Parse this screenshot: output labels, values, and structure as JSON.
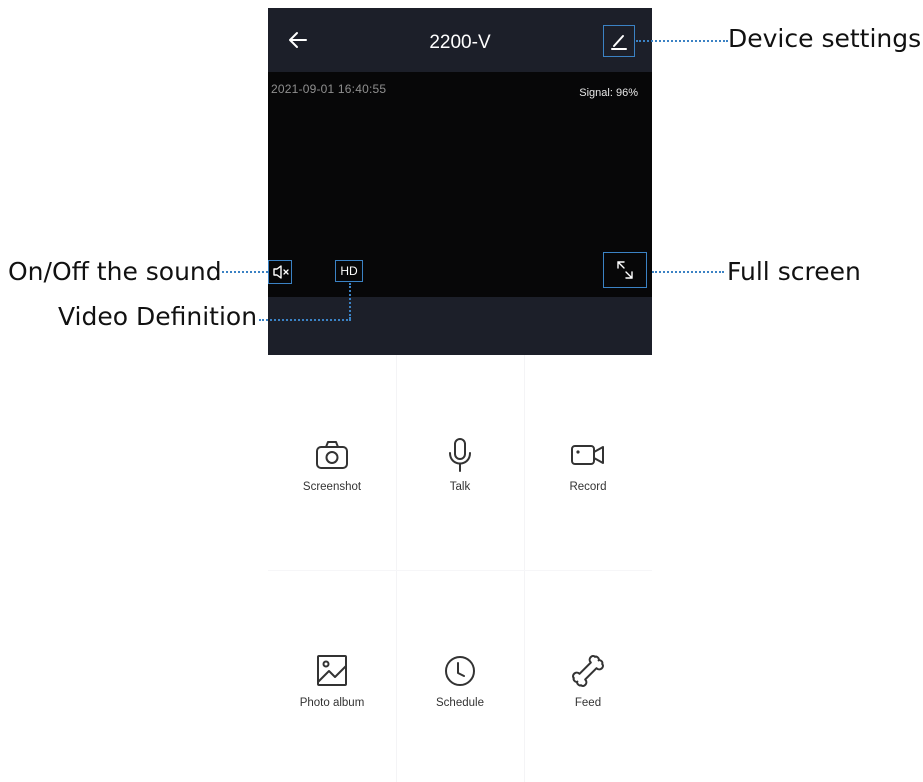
{
  "header": {
    "title": "2200-V"
  },
  "video": {
    "timestamp": "2021-09-01 16:40:55",
    "signal": "Signal: 96%",
    "hd_label": "HD"
  },
  "actions": [
    {
      "label": "Screenshot",
      "icon": "camera-icon"
    },
    {
      "label": "Talk",
      "icon": "microphone-icon"
    },
    {
      "label": "Record",
      "icon": "video-camera-icon"
    },
    {
      "label": "Photo album",
      "icon": "photo-album-icon"
    },
    {
      "label": "Schedule",
      "icon": "clock-icon"
    },
    {
      "label": "Feed",
      "icon": "bone-icon"
    }
  ],
  "annotations": {
    "device_settings": "Device settings",
    "sound": "On/Off the sound",
    "definition": "Video Definition",
    "fullscreen": "Full screen"
  },
  "colors": {
    "header_bg": "#1c1f29",
    "video_bg": "#070708",
    "annotation_accent": "#3b82c4"
  }
}
